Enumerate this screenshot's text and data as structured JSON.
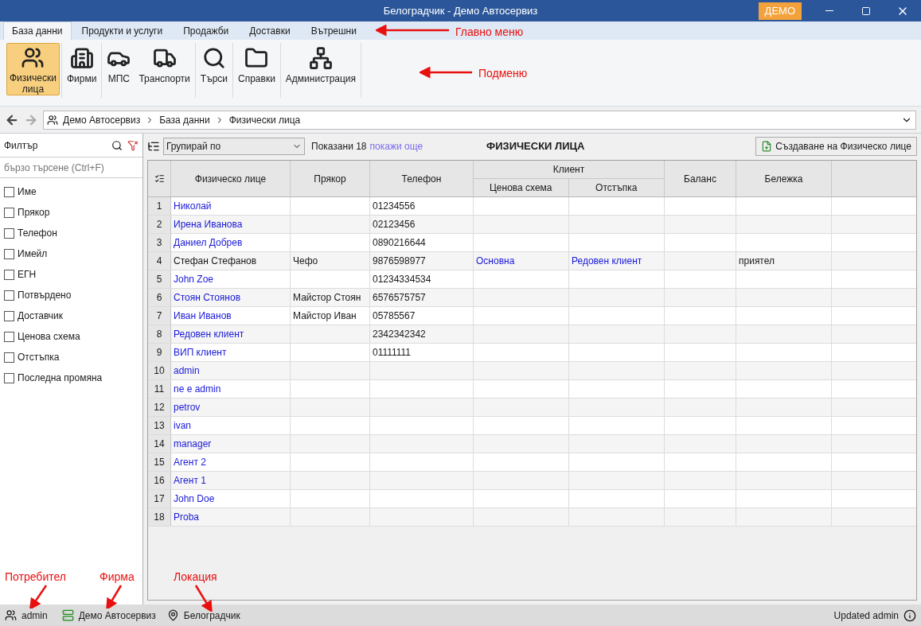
{
  "window": {
    "title": "Белоградчик - Демо Автосервиз",
    "badge": "ДЕМО"
  },
  "main_menu": [
    {
      "label": "База данни",
      "selected": true
    },
    {
      "label": "Продукти и услуги",
      "selected": false
    },
    {
      "label": "Продажби",
      "selected": false
    },
    {
      "label": "Доставки",
      "selected": false
    },
    {
      "label": "Вътрешни",
      "selected": false
    }
  ],
  "ribbon": [
    [
      {
        "label": "Физически\nлица",
        "kind": "people",
        "selected": true
      }
    ],
    [
      {
        "label": "Фирми",
        "kind": "building",
        "selected": false
      }
    ],
    [
      {
        "label": "МПС",
        "kind": "car",
        "selected": false
      },
      {
        "label": "Транспорти",
        "kind": "truck",
        "selected": false
      }
    ],
    [
      {
        "label": "Търси",
        "kind": "search",
        "selected": false
      }
    ],
    [
      {
        "label": "Справки",
        "kind": "folder",
        "selected": false
      }
    ],
    [
      {
        "label": "Администрация",
        "kind": "hierarchy",
        "selected": false
      }
    ]
  ],
  "breadcrumb": [
    "Демо Автосервиз",
    "База данни",
    "Физически лица"
  ],
  "filter": {
    "title": "Филтър",
    "placeholder": "бързо търсене (Ctrl+F)",
    "fields": [
      {
        "label": "Име",
        "checked": false
      },
      {
        "label": "Прякор",
        "checked": false
      },
      {
        "label": "Телефон",
        "checked": false
      },
      {
        "label": "Имейл",
        "checked": false
      },
      {
        "label": "ЕГН",
        "checked": false
      },
      {
        "label": "Потвърдено",
        "checked": false
      },
      {
        "label": "Доставчик",
        "checked": false
      },
      {
        "label": "Ценова схема",
        "checked": false
      },
      {
        "label": "Отстъпка",
        "checked": false
      },
      {
        "label": "Последна промяна",
        "checked": false
      }
    ]
  },
  "toolbar": {
    "group_by": "Групирай по",
    "shown": "Показани 18",
    "show_more": "покажи още",
    "title": "ФИЗИЧЕСКИ ЛИЦА",
    "create": "Създаване на Физическо лице"
  },
  "table": {
    "columns": [
      "Физическо лице",
      "Прякор",
      "Телефон",
      "Ценова схема",
      "Отстъпка",
      "Баланс",
      "Бележка"
    ],
    "group_header": "Клиент",
    "rows": [
      {
        "n": "1",
        "name": "Николай",
        "link": true,
        "nick": "",
        "phone": "01234556",
        "scheme": "",
        "discount": "",
        "balance": "",
        "note": ""
      },
      {
        "n": "2",
        "name": "Ирена Иванова",
        "link": true,
        "nick": "",
        "phone": "02123456",
        "scheme": "",
        "discount": "",
        "balance": "",
        "note": ""
      },
      {
        "n": "3",
        "name": "Даниел Добрев",
        "link": true,
        "nick": "",
        "phone": "0890216644",
        "scheme": "",
        "discount": "",
        "balance": "",
        "note": ""
      },
      {
        "n": "4",
        "name": "Стефан Стефанов",
        "link": false,
        "nick": "Чефо",
        "phone": "9876598977",
        "scheme": "Основна",
        "discount": "Редовен клиент",
        "balance": "",
        "note": "приятел"
      },
      {
        "n": "5",
        "name": "John Zoe",
        "link": true,
        "nick": "",
        "phone": "01234334534",
        "scheme": "",
        "discount": "",
        "balance": "",
        "note": ""
      },
      {
        "n": "6",
        "name": "Стоян Стоянов",
        "link": true,
        "nick": "Майстор Стоян",
        "phone": "6576575757",
        "scheme": "",
        "discount": "",
        "balance": "",
        "note": ""
      },
      {
        "n": "7",
        "name": "Иван Иванов",
        "link": true,
        "nick": "Майстор Иван",
        "phone": "05785567",
        "scheme": "",
        "discount": "",
        "balance": "",
        "note": ""
      },
      {
        "n": "8",
        "name": "Редовен клиент",
        "link": true,
        "nick": "",
        "phone": "2342342342",
        "scheme": "",
        "discount": "",
        "balance": "",
        "note": ""
      },
      {
        "n": "9",
        "name": "ВИП клиент",
        "link": true,
        "nick": "",
        "phone": "01111111",
        "scheme": "",
        "discount": "",
        "balance": "",
        "note": ""
      },
      {
        "n": "10",
        "name": "admin",
        "link": true,
        "nick": "",
        "phone": "",
        "scheme": "",
        "discount": "",
        "balance": "",
        "note": ""
      },
      {
        "n": "11",
        "name": "ne e admin",
        "link": true,
        "nick": "",
        "phone": "",
        "scheme": "",
        "discount": "",
        "balance": "",
        "note": ""
      },
      {
        "n": "12",
        "name": "petrov",
        "link": true,
        "nick": "",
        "phone": "",
        "scheme": "",
        "discount": "",
        "balance": "",
        "note": ""
      },
      {
        "n": "13",
        "name": "ivan",
        "link": true,
        "nick": "",
        "phone": "",
        "scheme": "",
        "discount": "",
        "balance": "",
        "note": ""
      },
      {
        "n": "14",
        "name": "manager",
        "link": true,
        "nick": "",
        "phone": "",
        "scheme": "",
        "discount": "",
        "balance": "",
        "note": ""
      },
      {
        "n": "15",
        "name": "Агент 2",
        "link": true,
        "nick": "",
        "phone": "",
        "scheme": "",
        "discount": "",
        "balance": "",
        "note": ""
      },
      {
        "n": "16",
        "name": "Агент 1",
        "link": true,
        "nick": "",
        "phone": "",
        "scheme": "",
        "discount": "",
        "balance": "",
        "note": ""
      },
      {
        "n": "17",
        "name": "John Doe",
        "link": true,
        "nick": "",
        "phone": "",
        "scheme": "",
        "discount": "",
        "balance": "",
        "note": ""
      },
      {
        "n": "18",
        "name": "Proba",
        "link": true,
        "nick": "",
        "phone": "",
        "scheme": "",
        "discount": "",
        "balance": "",
        "note": ""
      }
    ]
  },
  "status_bar": {
    "user": "admin",
    "company": "Демо Автосервиз",
    "location": "Белоградчик",
    "updated": "Updated admin"
  },
  "annotations": [
    "Главно меню",
    "Подменю",
    "Потребител",
    "Фирма",
    "Локация"
  ]
}
